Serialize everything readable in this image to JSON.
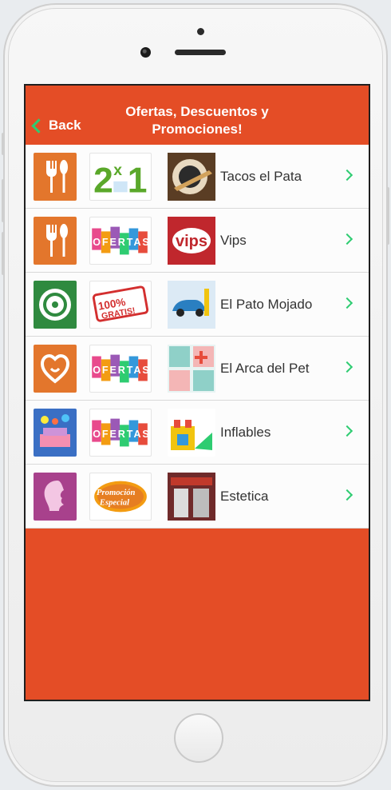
{
  "header": {
    "back_label": "Back",
    "title": "Ofertas, Descuentos y Promociones!"
  },
  "list_items": [
    {
      "name": "Tacos el Pata",
      "category_icon": "cutlery-icon",
      "promo_badge": "2x1"
    },
    {
      "name": "Vips",
      "category_icon": "cutlery-icon",
      "promo_badge": "OFERTAS"
    },
    {
      "name": "El Pato Mojado",
      "category_icon": "tire-icon",
      "promo_badge": "100% GRATIS!"
    },
    {
      "name": "El Arca del Pet",
      "category_icon": "pet-icon",
      "promo_badge": "OFERTAS"
    },
    {
      "name": "Inflables",
      "category_icon": "party-icon",
      "promo_badge": "OFERTAS"
    },
    {
      "name": "Estetica",
      "category_icon": "woman-profile-icon",
      "promo_badge": "Promoción Especial"
    }
  ],
  "colors": {
    "brand": "#e44d26",
    "accent": "#2ecc71"
  }
}
